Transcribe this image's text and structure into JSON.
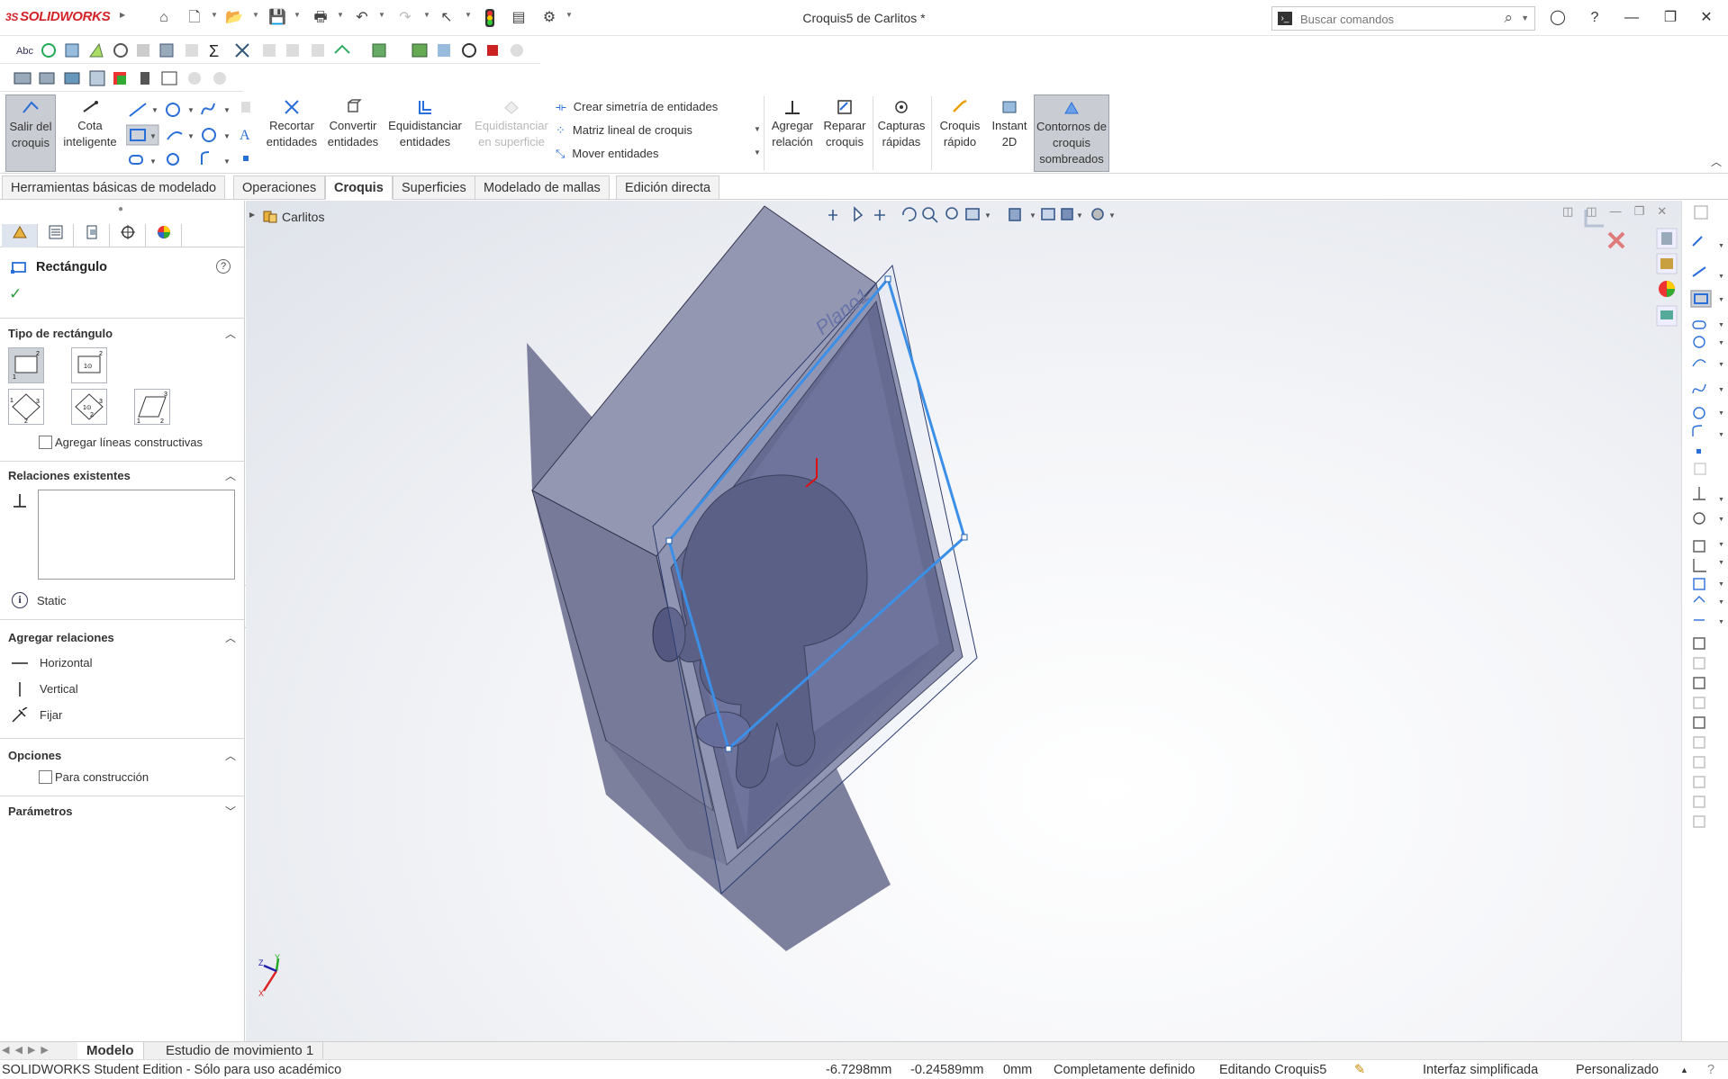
{
  "app": {
    "brand": "SOLIDWORKS",
    "window_title": "Croquis5 de Carlitos *",
    "search_placeholder": "Buscar comandos"
  },
  "command_manager": {
    "exit_sketch": "Salir del croquis",
    "smart_dimension": "Cota inteligente",
    "trim": "Recortar entidades",
    "convert": "Convertir entidades",
    "offset": "Equidistanciar entidades",
    "offset_surface": "Equidistanciar en superficie",
    "mirror": "Crear simetría de entidades",
    "linear_pattern": "Matriz lineal de croquis",
    "move": "Mover entidades",
    "add_relation": "Agregar relación",
    "repair": "Reparar croquis",
    "quick_snaps": "Capturas rápidas",
    "rapid_sketch": "Croquis rápido",
    "instant2d": "Instant 2D",
    "shaded_contours": "Contornos de croquis sombreados"
  },
  "tabs": [
    {
      "label": "Herramientas básicas de modelado"
    },
    {
      "label": "Operaciones"
    },
    {
      "label": "Croquis"
    },
    {
      "label": "Superficies"
    },
    {
      "label": "Modelado de mallas"
    },
    {
      "label": "Edición directa"
    }
  ],
  "property_manager": {
    "title": "Rectángulo",
    "rect_type_header": "Tipo de rectángulo",
    "construction_lines": "Agregar líneas constructivas",
    "existing_relations_header": "Relaciones existentes",
    "status": "Static",
    "add_relations_header": "Agregar relaciones",
    "relations": [
      {
        "label": "Horizontal"
      },
      {
        "label": "Vertical"
      },
      {
        "label": "Fijar"
      }
    ],
    "options_header": "Opciones",
    "for_construction": "Para construcción",
    "parameters_header": "Parámetros"
  },
  "tree": {
    "part_name": "Carlitos"
  },
  "viewport": {
    "plane_label": "Plano1",
    "colors": {
      "box_face_top": "#8f93ad",
      "box_face_side": "#7a7e9a",
      "inner": "#5b5f85",
      "sketch_blue": "#3b8fe6"
    }
  },
  "bottom_tabs": [
    {
      "label": "Modelo"
    },
    {
      "label": "Estudio de movimiento 1"
    }
  ],
  "status": {
    "edition": "SOLIDWORKS Student Edition - Sólo para uso académico",
    "x": "-6.7298mm",
    "y": "-0.24589mm",
    "z": "0mm",
    "definition": "Completamente definido",
    "editing": "Editando Croquis5",
    "interface": "Interfaz simplificada",
    "units": "Personalizado"
  }
}
